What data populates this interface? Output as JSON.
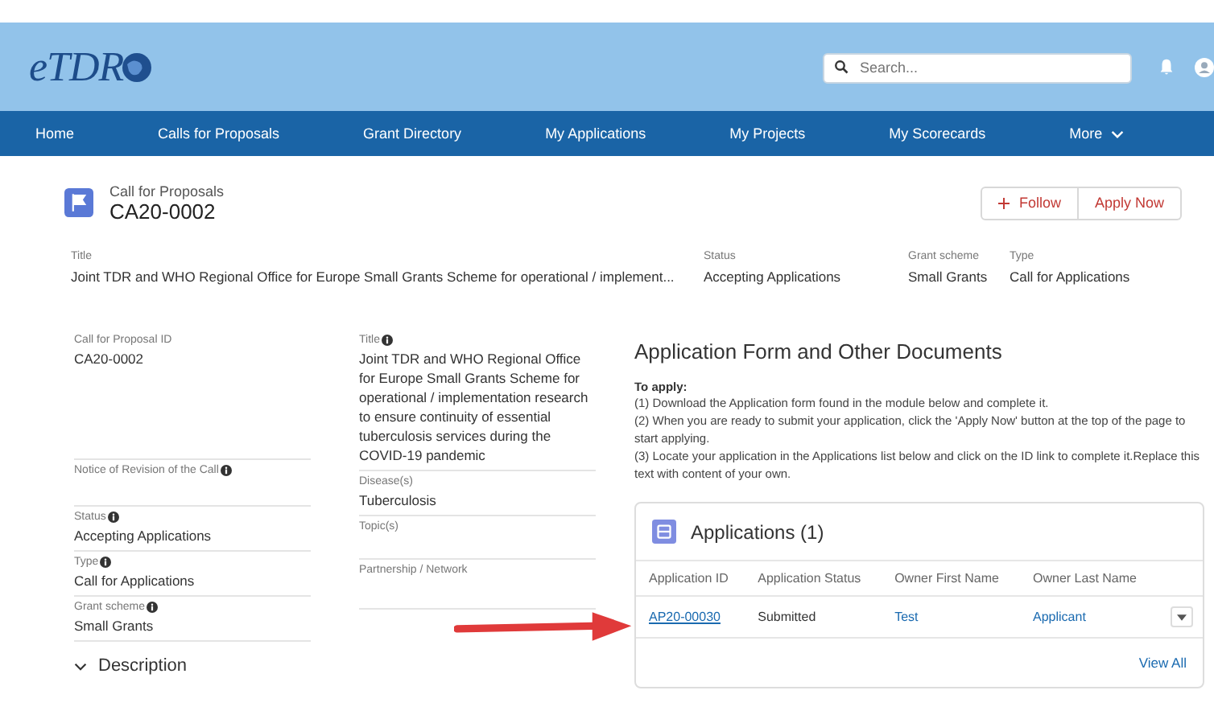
{
  "header": {
    "logo": "eTDR",
    "search": {
      "placeholder": "Search..."
    }
  },
  "nav": [
    {
      "label": "Home",
      "selected": false
    },
    {
      "label": "Calls for Proposals",
      "selected": false
    },
    {
      "label": "Grant Directory",
      "selected": false
    },
    {
      "label": "My Applications",
      "selected": false
    },
    {
      "label": "My Projects",
      "selected": false
    },
    {
      "label": "My Scorecards",
      "selected": false
    },
    {
      "label": "More",
      "selected": false,
      "kind": "dropdown"
    }
  ],
  "record": {
    "type": "Call for Proposals",
    "name": "CA20-0002",
    "buttons": [
      {
        "label": "Follow",
        "kind": "follow"
      },
      {
        "label": "Apply Now",
        "kind": "plain"
      }
    ]
  },
  "highlights": [
    {
      "label": "Title",
      "value": "Joint TDR and WHO Regional Office for Europe Small Grants Scheme for operational / implement..."
    },
    {
      "label": "Status",
      "value": "Accepting Applications"
    },
    {
      "label": "Grant scheme",
      "value": "Small Grants"
    },
    {
      "label": "Type",
      "value": "Call for Applications"
    }
  ],
  "details_left": [
    {
      "label": "Call for Proposal ID",
      "value": "CA20-0002",
      "info": false
    },
    {
      "label": "Notice of Revision of the Call",
      "info": true
    },
    {
      "label": "Status",
      "value": "Accepting Applications",
      "info": true
    },
    {
      "label": "Type",
      "value": "Call for Applications",
      "info": true
    },
    {
      "label": "Grant scheme",
      "value": "Small Grants",
      "info": true
    }
  ],
  "details_right": [
    {
      "label": "Title",
      "value": "Joint TDR and WHO Regional Office for Europe Small Grants Scheme for operational / implementation research to ensure continuity of essential tuberculosis services during the COVID-19 pandemic",
      "info": true
    },
    {
      "label": "Disease(s)",
      "value": "Tuberculosis",
      "info": false
    },
    {
      "label": "Topic(s)",
      "info": false
    },
    {
      "label": "Partnership / Network",
      "info": false
    }
  ],
  "section": {
    "label": "Description",
    "expanded": true
  },
  "documents": {
    "heading": "Application Form and Other Documents",
    "intro": "To apply:",
    "steps": [
      "(1) Download the Application form found in the module below and complete it.",
      "(2) When you are ready to submit your application, click the 'Apply Now' button at the top of the page to start applying.",
      "(3) Locate your application in the Applications list below and click on the ID link to complete it.Replace this text with content of your own."
    ]
  },
  "applications": {
    "title": "Applications (1)",
    "columns": [
      "Application ID",
      "Application Status",
      "Owner First Name",
      "Owner Last Name"
    ],
    "rows": [
      {
        "cells": [
          {
            "text": "AP20-00030",
            "kind": "link"
          },
          {
            "text": "Submitted",
            "kind": "text"
          },
          {
            "text": "Test",
            "kind": "link"
          },
          {
            "text": "Applicant",
            "kind": "link"
          }
        ]
      }
    ],
    "view_all": "View All"
  }
}
